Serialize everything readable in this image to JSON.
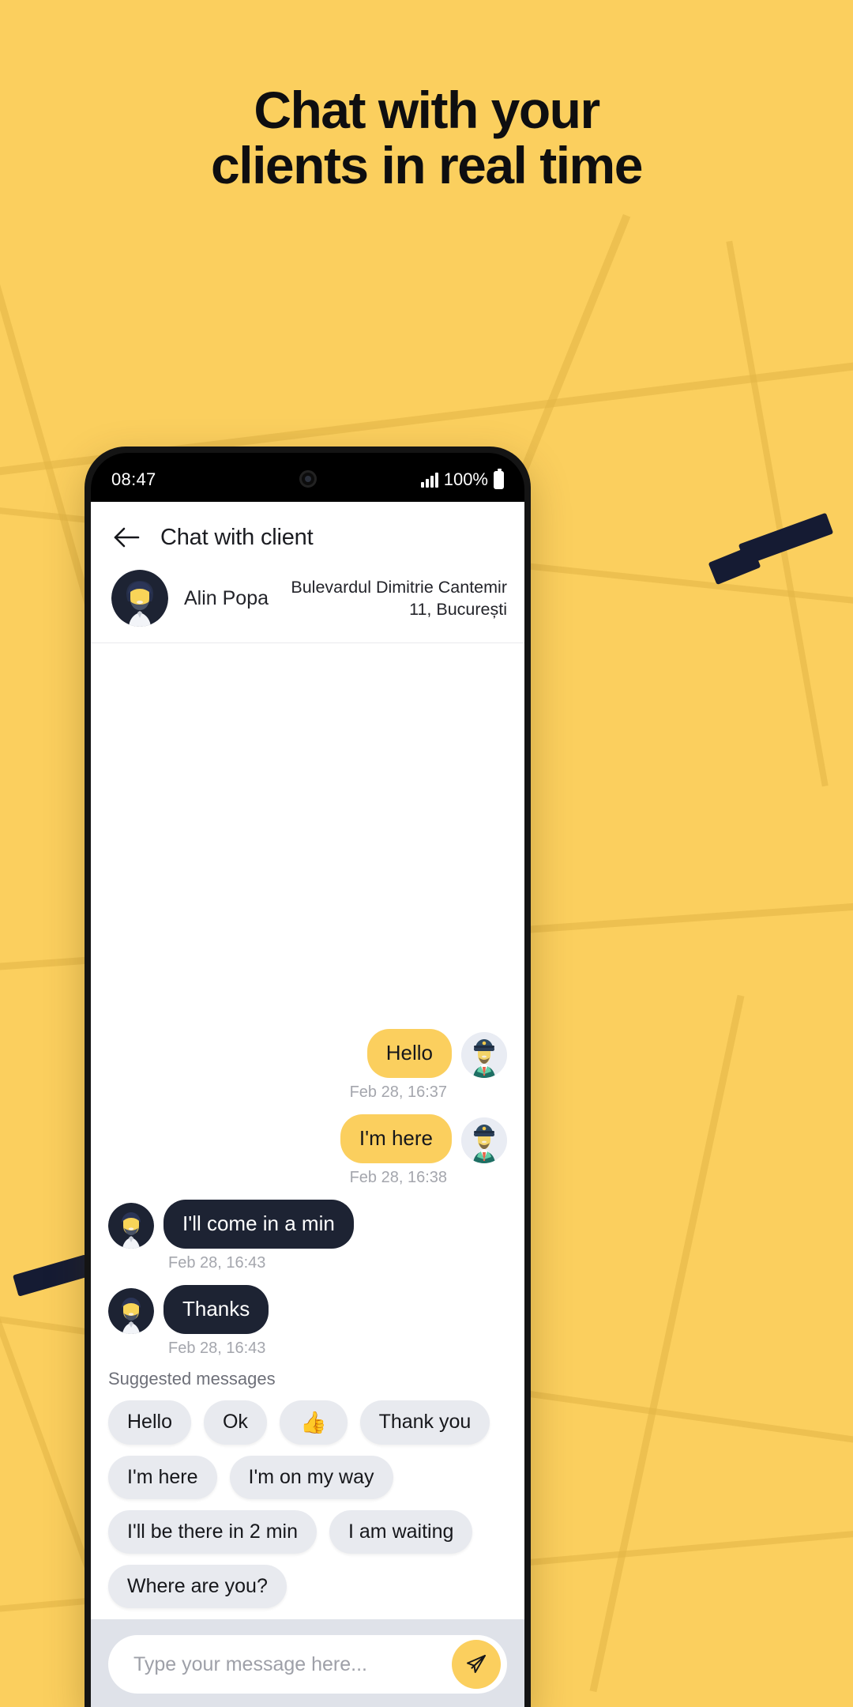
{
  "promo": {
    "headline": "Chat with your\nclients in real time",
    "background_color": "#FBCF5E",
    "accent_color": "#FBCF5E",
    "dark_color": "#1D2333"
  },
  "status_bar": {
    "time": "08:47",
    "battery_percent": "100%",
    "signal_icon": "signal-bars-icon",
    "battery_icon": "battery-full-icon",
    "camera_icon": "front-camera-icon"
  },
  "app_header": {
    "back_icon": "back-arrow-icon",
    "title": "Chat with client"
  },
  "client": {
    "avatar_icon": "client-avatar",
    "name": "Alin Popa",
    "address_line1": "Bulevardul Dimitrie Cantemir",
    "address_line2": "11, București"
  },
  "messages": [
    {
      "id": 1,
      "direction": "out",
      "text": "Hello",
      "time": "Feb 28, 16:37",
      "avatar": "driver-avatar"
    },
    {
      "id": 2,
      "direction": "out",
      "text": "I'm here",
      "time": "Feb 28, 16:38",
      "avatar": "driver-avatar"
    },
    {
      "id": 3,
      "direction": "in",
      "text": "I'll come in a min",
      "time": "Feb 28, 16:43",
      "avatar": "client-avatar"
    },
    {
      "id": 4,
      "direction": "in",
      "text": "Thanks",
      "time": "Feb 28, 16:43",
      "avatar": "client-avatar"
    }
  ],
  "suggested": {
    "label": "Suggested messages",
    "chips": [
      "Hello",
      "Ok",
      "👍",
      "Thank you",
      "I'm here",
      "I'm on my way",
      "I'll be there in 2 min",
      "I am waiting",
      "Where are you?"
    ]
  },
  "composer": {
    "placeholder": "Type your message here...",
    "value": "",
    "send_icon": "send-paper-plane-icon"
  }
}
